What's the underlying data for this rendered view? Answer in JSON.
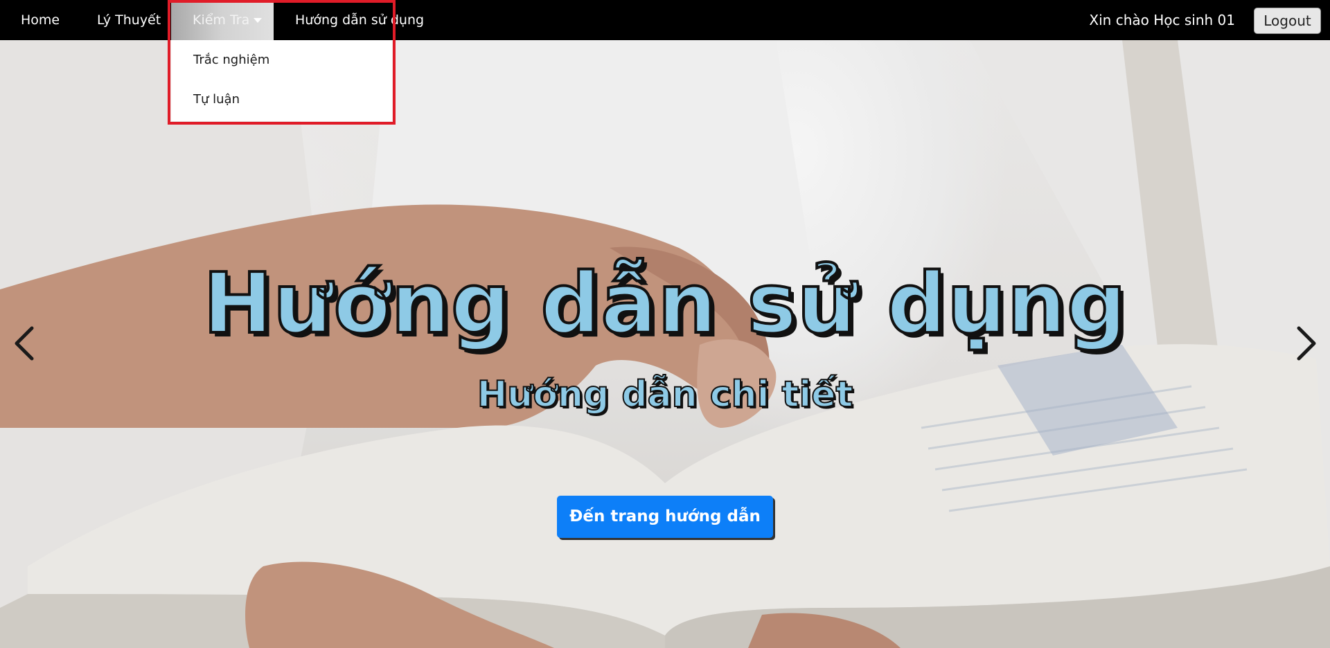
{
  "navbar": {
    "home": "Home",
    "ly_thuyet": "Lý Thuyết",
    "kiem_tra": "Kiểm Tra",
    "huong_dan": "Hướng dẫn sử dụng",
    "greeting": "Xin chào Học sinh 01",
    "logout": "Logout"
  },
  "dropdown": {
    "items": [
      {
        "label": "Trắc nghiệm"
      },
      {
        "label": "Tự luận"
      }
    ]
  },
  "carousel": {
    "title": "Hướng dẫn sử dụng",
    "subtitle": "Hướng dẫn chi tiết",
    "cta": "Đến trang hướng dẫn",
    "prev_icon": "chevron-left-icon",
    "next_icon": "chevron-right-icon"
  },
  "colors": {
    "navbar_bg": "#000000",
    "accent_blue": "#0d7ff8",
    "caption_fill": "#8ecae6",
    "highlight_red": "#e01c28"
  }
}
